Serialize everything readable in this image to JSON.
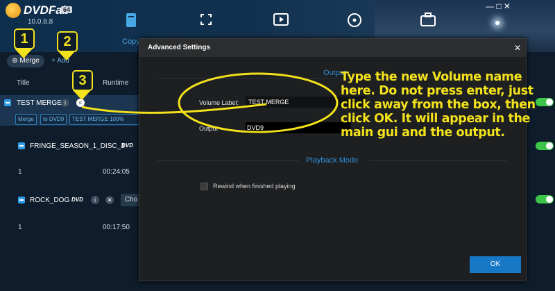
{
  "app": {
    "logo_text": "DVDFab",
    "logo_badge": "64",
    "version": "10.0.8.8",
    "active_module_label": "Copy",
    "window_controls": "— □ ✕"
  },
  "toolbar": {
    "merge_label": "Merge",
    "add_label": "Add"
  },
  "list": {
    "columns": {
      "title": "Title",
      "runtime": "Runtime"
    },
    "merge_title": "TEST MERGE",
    "merge_tags": [
      "Merge",
      "to DVD9",
      "TEST MERGE 100%"
    ],
    "titles": [
      {
        "name": "FRINGE_SEASON_1_DISC_3",
        "track": "1",
        "runtime": "00:24:05"
      },
      {
        "name": "ROCK_DOG",
        "track": "1",
        "runtime": "00:17:50",
        "choose_label": "Cho"
      }
    ],
    "dvd_logo": "DVD"
  },
  "badges": [
    "1",
    "2",
    "3"
  ],
  "dialog": {
    "title": "Advanced Settings",
    "close_icon": "✕",
    "output_section": "Output",
    "volume_label_caption": "Volume Label:",
    "volume_label_value": "TEST MERGE",
    "output_caption": "Output",
    "output_value": "DVD9",
    "playback_section": "Playback Mode",
    "rewind_label": "Rewind when finished playing",
    "ok_label": "OK"
  },
  "annotation": {
    "text": "Type the new Volume name here. Do not press enter, just click away from the box, then click OK. It will appear in the main gui and the output.",
    "color": "#f3e21c"
  },
  "colors": {
    "accent": "#2f9ee8",
    "ok_button": "#1778c6",
    "toggle_on": "#3dc54a"
  }
}
